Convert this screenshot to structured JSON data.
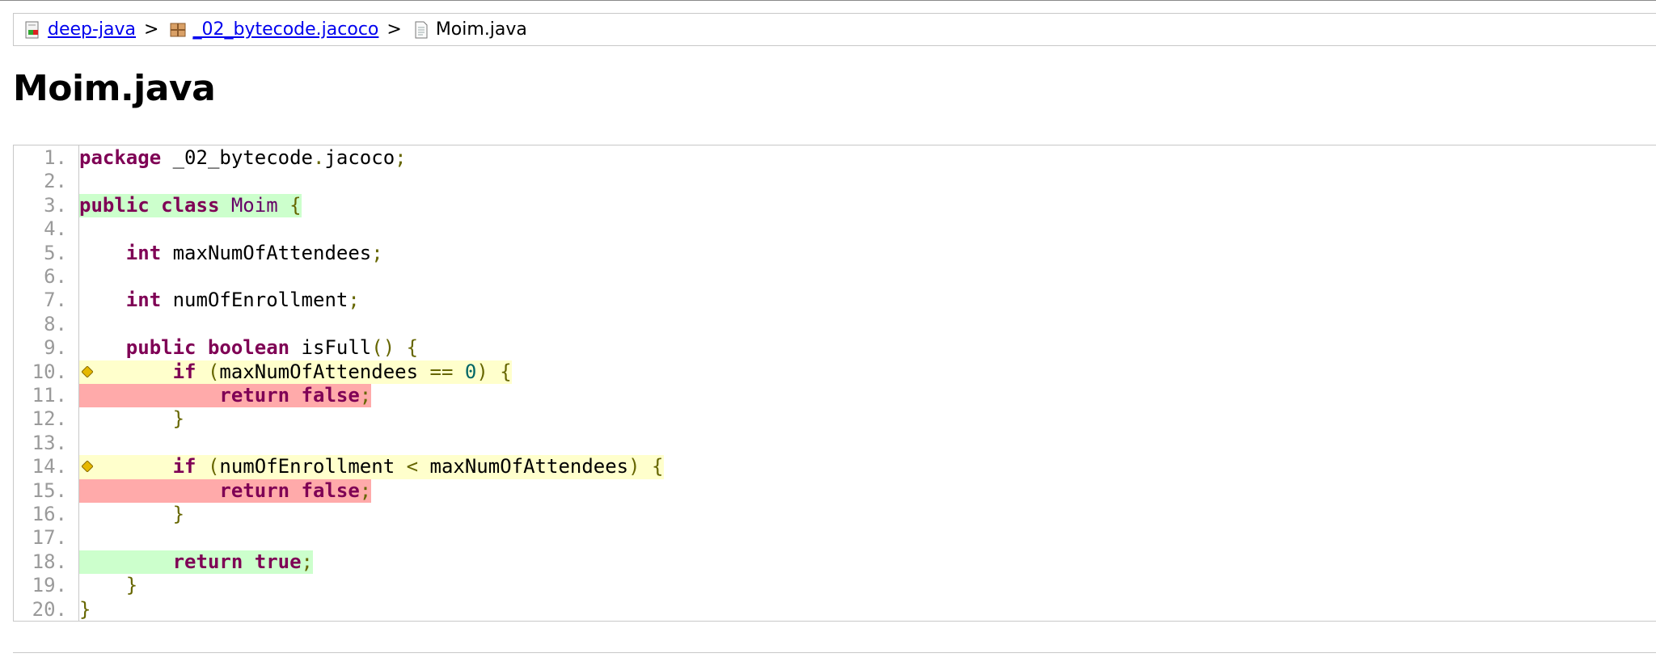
{
  "breadcrumb": {
    "items": [
      {
        "label": "deep-java",
        "icon": "report-icon",
        "link": true
      },
      {
        "label": "_02_bytecode.jacoco",
        "icon": "package-icon",
        "link": true
      },
      {
        "label": "Moim.java",
        "icon": "source-file-icon",
        "link": false
      }
    ],
    "separator": ">"
  },
  "page_title": "Moim.java",
  "coverage_colors": {
    "fully_covered": "#ccffcc",
    "not_covered": "#ffaaaa",
    "partly_covered": "#ffffcc",
    "branch_marker": "#e6b800"
  },
  "source": {
    "lines": [
      {
        "n": "1.",
        "text": "package _02_bytecode.jacoco;",
        "status": "none"
      },
      {
        "n": "2.",
        "text": "",
        "status": "none"
      },
      {
        "n": "3.",
        "text": "public class Moim {",
        "status": "fc"
      },
      {
        "n": "4.",
        "text": "",
        "status": "none"
      },
      {
        "n": "5.",
        "text": "    int maxNumOfAttendees;",
        "status": "none"
      },
      {
        "n": "6.",
        "text": "",
        "status": "none"
      },
      {
        "n": "7.",
        "text": "    int numOfEnrollment;",
        "status": "none"
      },
      {
        "n": "8.",
        "text": "",
        "status": "none"
      },
      {
        "n": "9.",
        "text": "    public boolean isFull() {",
        "status": "none"
      },
      {
        "n": "10.",
        "text": "        if (maxNumOfAttendees == 0) {",
        "status": "pc",
        "branch": true
      },
      {
        "n": "11.",
        "text": "            return false;",
        "status": "nc"
      },
      {
        "n": "12.",
        "text": "        }",
        "status": "none"
      },
      {
        "n": "13.",
        "text": "",
        "status": "none"
      },
      {
        "n": "14.",
        "text": "        if (numOfEnrollment < maxNumOfAttendees) {",
        "status": "pc",
        "branch": true
      },
      {
        "n": "15.",
        "text": "            return false;",
        "status": "nc"
      },
      {
        "n": "16.",
        "text": "        }",
        "status": "none"
      },
      {
        "n": "17.",
        "text": "",
        "status": "none"
      },
      {
        "n": "18.",
        "text": "        return true;",
        "status": "fc"
      },
      {
        "n": "19.",
        "text": "    }",
        "status": "none"
      },
      {
        "n": "20.",
        "text": "}",
        "status": "none"
      }
    ]
  }
}
